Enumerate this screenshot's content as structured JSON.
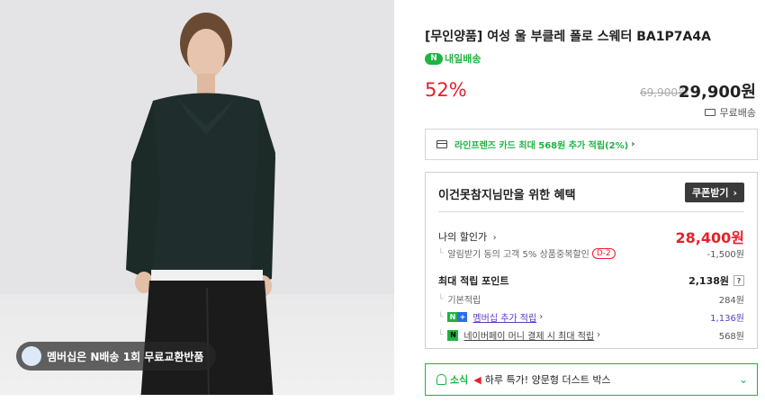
{
  "product": {
    "title": "[무인양품] 여성 울 부클레 폴로 스웨터 BA1P7A4A",
    "delivery_badge": "N",
    "delivery_label": "내일배송",
    "discount_rate": "52%",
    "original_price": "69,900원",
    "sale_price": "29,900원",
    "shipping": "무료배송",
    "membership_badge": "멤버십은 N배송 1회 무료교환반품"
  },
  "card_promo": {
    "text": "라인프렌즈 카드 최대 568원 추가 적립(2%)",
    "chevron": "›"
  },
  "benefit": {
    "heading": "이건못참지님만을 위한 혜택",
    "coupon_button": "쿠폰받기",
    "coupon_chevron": "›",
    "my_price_label": "나의 할인가",
    "my_price": "28,400원",
    "alert_coupon_label": "알림받기 동의 고객 5% 상품중복할인",
    "alert_coupon_tag": "D-2",
    "alert_coupon_value": "-1,500원",
    "max_points_label": "최대 적립 포인트",
    "max_points": "2,138원",
    "help": "?",
    "base_points_label": "기본적립",
    "base_points": "284원",
    "membership_label": "멤버십 추가 적립",
    "membership_points": "1,136원",
    "npay_label": "네이버페이 머니 결제 시 최대 적립",
    "npay_points": "568원",
    "npay_badge": "N",
    "nplus_n": "N",
    "nplus_plus": "+"
  },
  "notice": {
    "label": "소식",
    "text": "하루 특가! 양문형 더스트 박스",
    "chevron": "⌄"
  },
  "colors": {
    "accent_green": "#1eb441",
    "sale_red": "#e8202a",
    "link_purple": "#5a3cc8"
  },
  "icons": [
    "truck-icon",
    "card-icon",
    "bell-icon",
    "megaphone-icon",
    "chevron-right-icon",
    "chevron-down-icon"
  ]
}
